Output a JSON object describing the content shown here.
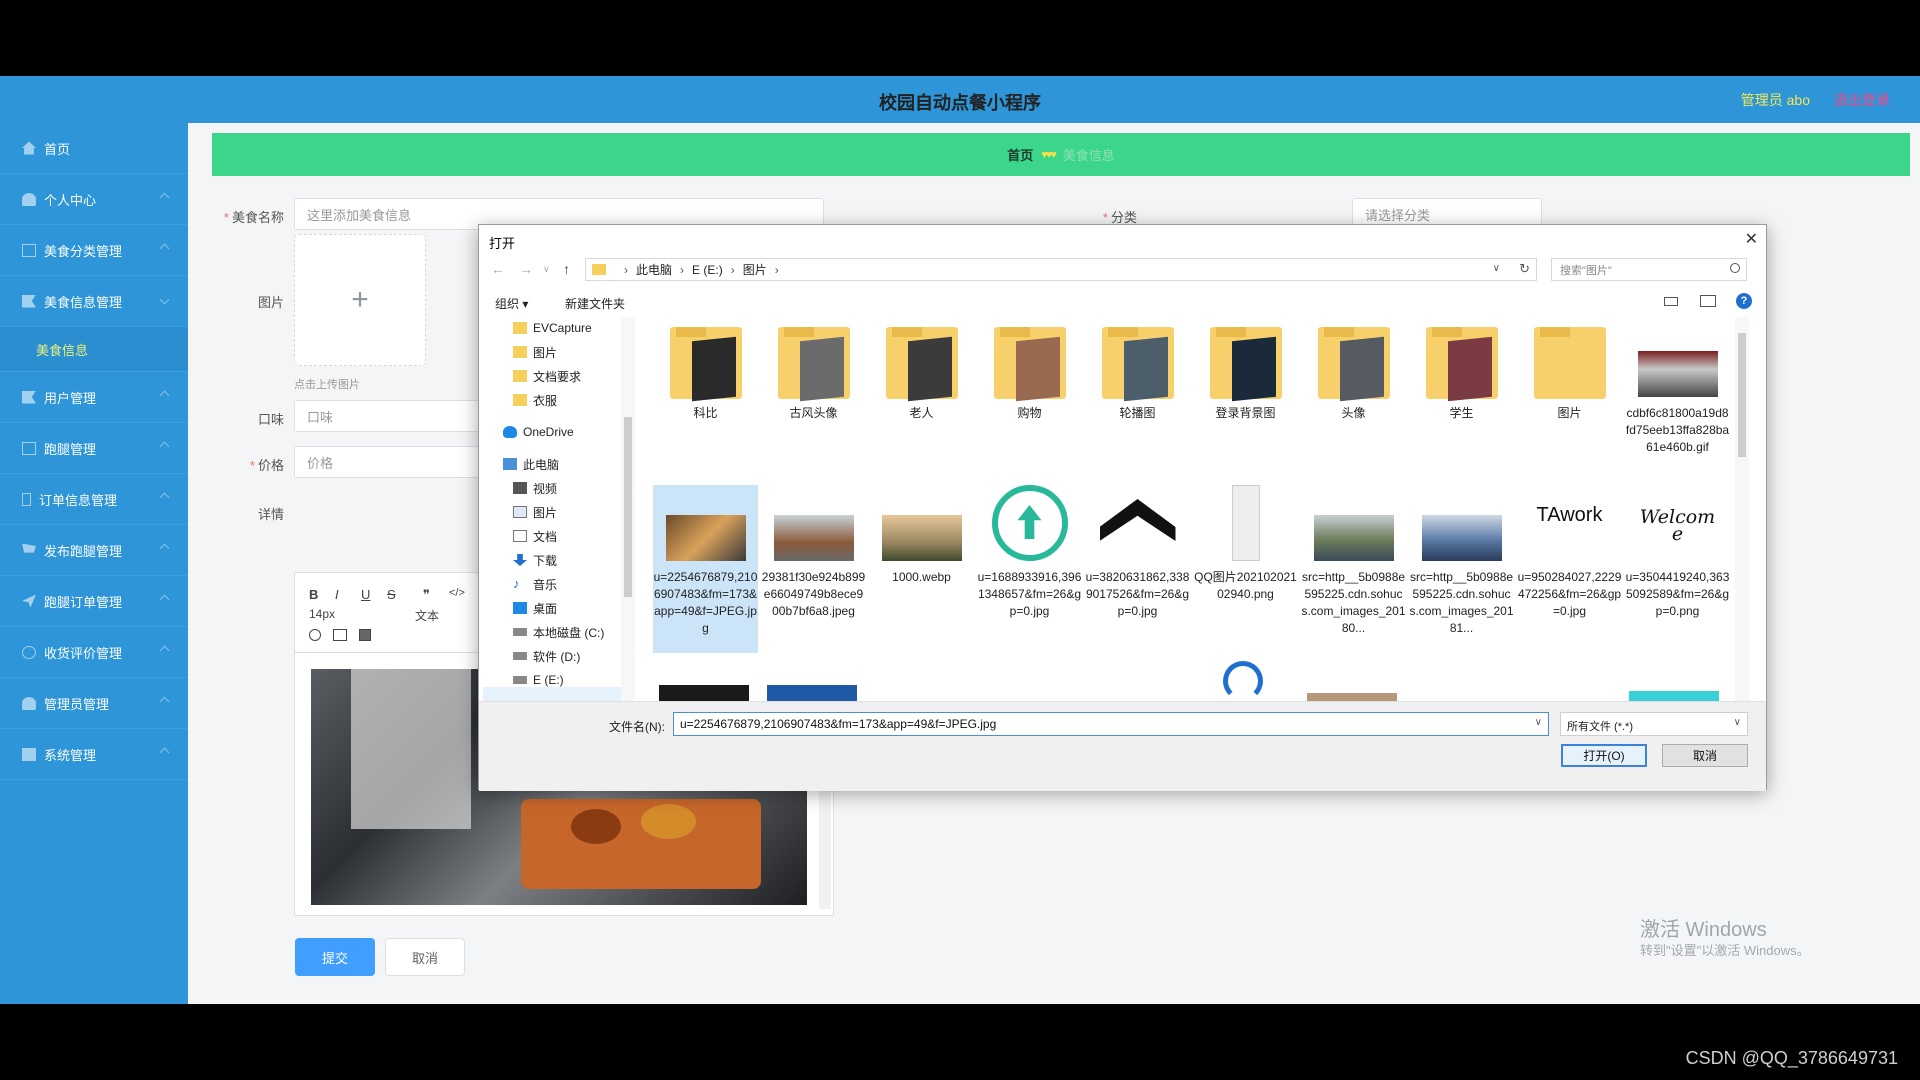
{
  "app": {
    "title": "校园自动点餐小程序",
    "admin": "管理员 abo",
    "logout": "退出登录"
  },
  "sidebar": {
    "items": [
      {
        "label": "首页"
      },
      {
        "label": "个人中心"
      },
      {
        "label": "美食分类管理"
      },
      {
        "label": "美食信息管理",
        "sub": "美食信息"
      },
      {
        "label": "用户管理"
      },
      {
        "label": "跑腿管理"
      },
      {
        "label": "订单信息管理"
      },
      {
        "label": "发布跑腿管理"
      },
      {
        "label": "跑腿订单管理"
      },
      {
        "label": "收货评价管理"
      },
      {
        "label": "管理员管理"
      },
      {
        "label": "系统管理"
      }
    ]
  },
  "breadcrumb": {
    "home": "首页",
    "current": "美食信息",
    "sep": "♥♥♥"
  },
  "form": {
    "name_label": "美食名称",
    "name_placeholder": "这里添加美食信息",
    "category_label": "分类",
    "category_placeholder": "请选择分类",
    "image_label": "图片",
    "upload_plus": "+",
    "upload_hint": "点击上传图片",
    "taste_label": "口味",
    "taste_placeholder": "口味",
    "price_label": "价格",
    "price_placeholder": "价格",
    "detail_label": "详情",
    "toolbar": {
      "bold": "B",
      "italic": "I",
      "underline": "U",
      "strike": "S",
      "quote": "❞",
      "code": "</>",
      "fontsize": "14px",
      "text": "文本"
    },
    "submit": "提交",
    "cancel": "取消"
  },
  "dialog": {
    "title": "打开",
    "path": [
      "此电脑",
      "E (E:)",
      "图片"
    ],
    "search_placeholder": "搜索\"图片\"",
    "organize": "组织 ▾",
    "new_folder": "新建文件夹",
    "tree": [
      "EVCapture",
      "图片",
      "文档要求",
      "衣服",
      "OneDrive",
      "此电脑",
      "视频",
      "图片",
      "文档",
      "下载",
      "音乐",
      "桌面",
      "本地磁盘 (C:)",
      "软件 (D:)",
      "E (E:)"
    ],
    "files_row1": [
      "科比",
      "古风头像",
      "老人",
      "购物",
      "轮播图",
      "登录背景图",
      "头像",
      "学生",
      "图片",
      "cdbf6c81800a19d8fd75eeb13ffa828ba61e460b.gif"
    ],
    "files_row2": [
      "u=2254676879,2106907483&fm=173&app=49&f=JPEG.jpg",
      "29381f30e924b899e66049749b8ece900b7bf6a8.jpeg",
      "1000.webp",
      "u=1688933916,3961348657&fm=26&gp=0.jpg",
      "u=3820631862,3389017526&fm=26&gp=0.jpg",
      "QQ图片20210202102940.png",
      "src=http__5b0988e595225.cdn.sohucs.com_images_20180...",
      "src=http__5b0988e595225.cdn.sohucs.com_images_20181...",
      "u=950284027,2229472256&fm=26&gp=0.jpg",
      "u=3504419240,3635092589&fm=26&gp=0.png"
    ],
    "thumb_text_tawork": "TAwork",
    "thumb_text_welcome": "Welcome",
    "filename_label": "文件名(N):",
    "filename_value": "u=2254676879,2106907483&fm=173&app=49&f=JPEG.jpg",
    "filetype": "所有文件 (*.*)",
    "open": "打开(O)",
    "cancel": "取消"
  },
  "watermark": {
    "line1": "激活 Windows",
    "line2": "转到\"设置\"以激活 Windows。"
  },
  "csdn": "CSDN @QQ_3786649731",
  "colors": {
    "topbar": "#2d95d8",
    "breadcrumb": "#3bd68c",
    "primary_button": "#409eff"
  }
}
